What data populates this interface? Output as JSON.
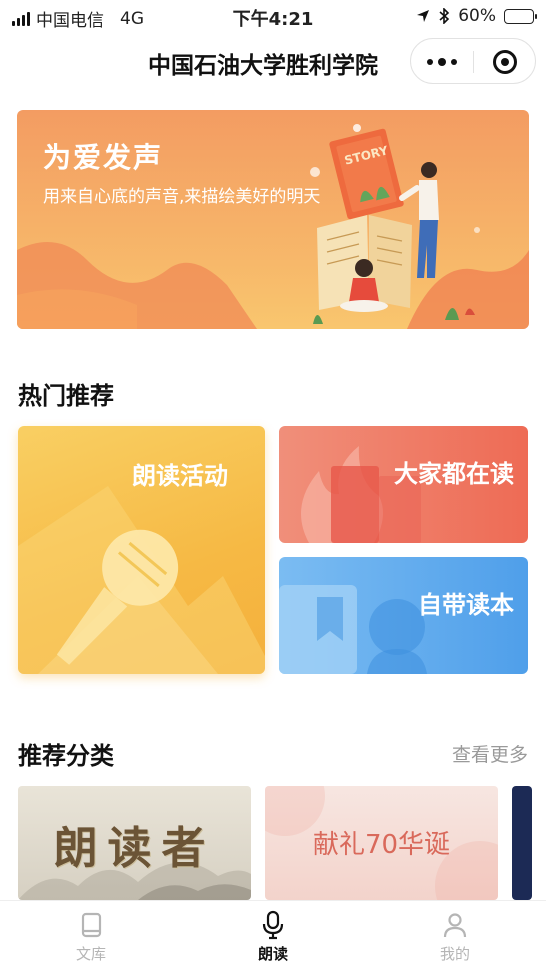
{
  "status_bar": {
    "carrier": "中国电信",
    "network": "4G",
    "time": "下午4:21",
    "battery_percent": "60%",
    "battery_level": 0.6
  },
  "nav": {
    "title": "中国石油大学胜利学院"
  },
  "banner": {
    "title": "为爱发声",
    "subtitle": "用来自心底的声音,来描绘美好的明天",
    "book_text": "STORY"
  },
  "hot": {
    "title": "热门推荐",
    "cards": [
      {
        "label": "朗读活动",
        "icon": "microphone-icon"
      },
      {
        "label": "大家都在读",
        "icon": "flame-icon"
      },
      {
        "label": "自带读本",
        "icon": "bookmark-icon"
      }
    ]
  },
  "categories": {
    "title": "推荐分类",
    "more": "查看更多",
    "items": [
      {
        "text": "朗读者"
      },
      {
        "text": "献礼70华诞"
      }
    ]
  },
  "tabbar": {
    "items": [
      {
        "label": "文库",
        "icon": "book-icon",
        "active": false
      },
      {
        "label": "朗读",
        "icon": "microphone-icon",
        "active": true
      },
      {
        "label": "我的",
        "icon": "user-icon",
        "active": false
      }
    ]
  },
  "colors": {
    "banner": "#f39c62",
    "card_read": "#f6b944",
    "card_all": "#ee6b55",
    "card_own": "#4f9fea",
    "battery": "#f5c518"
  }
}
